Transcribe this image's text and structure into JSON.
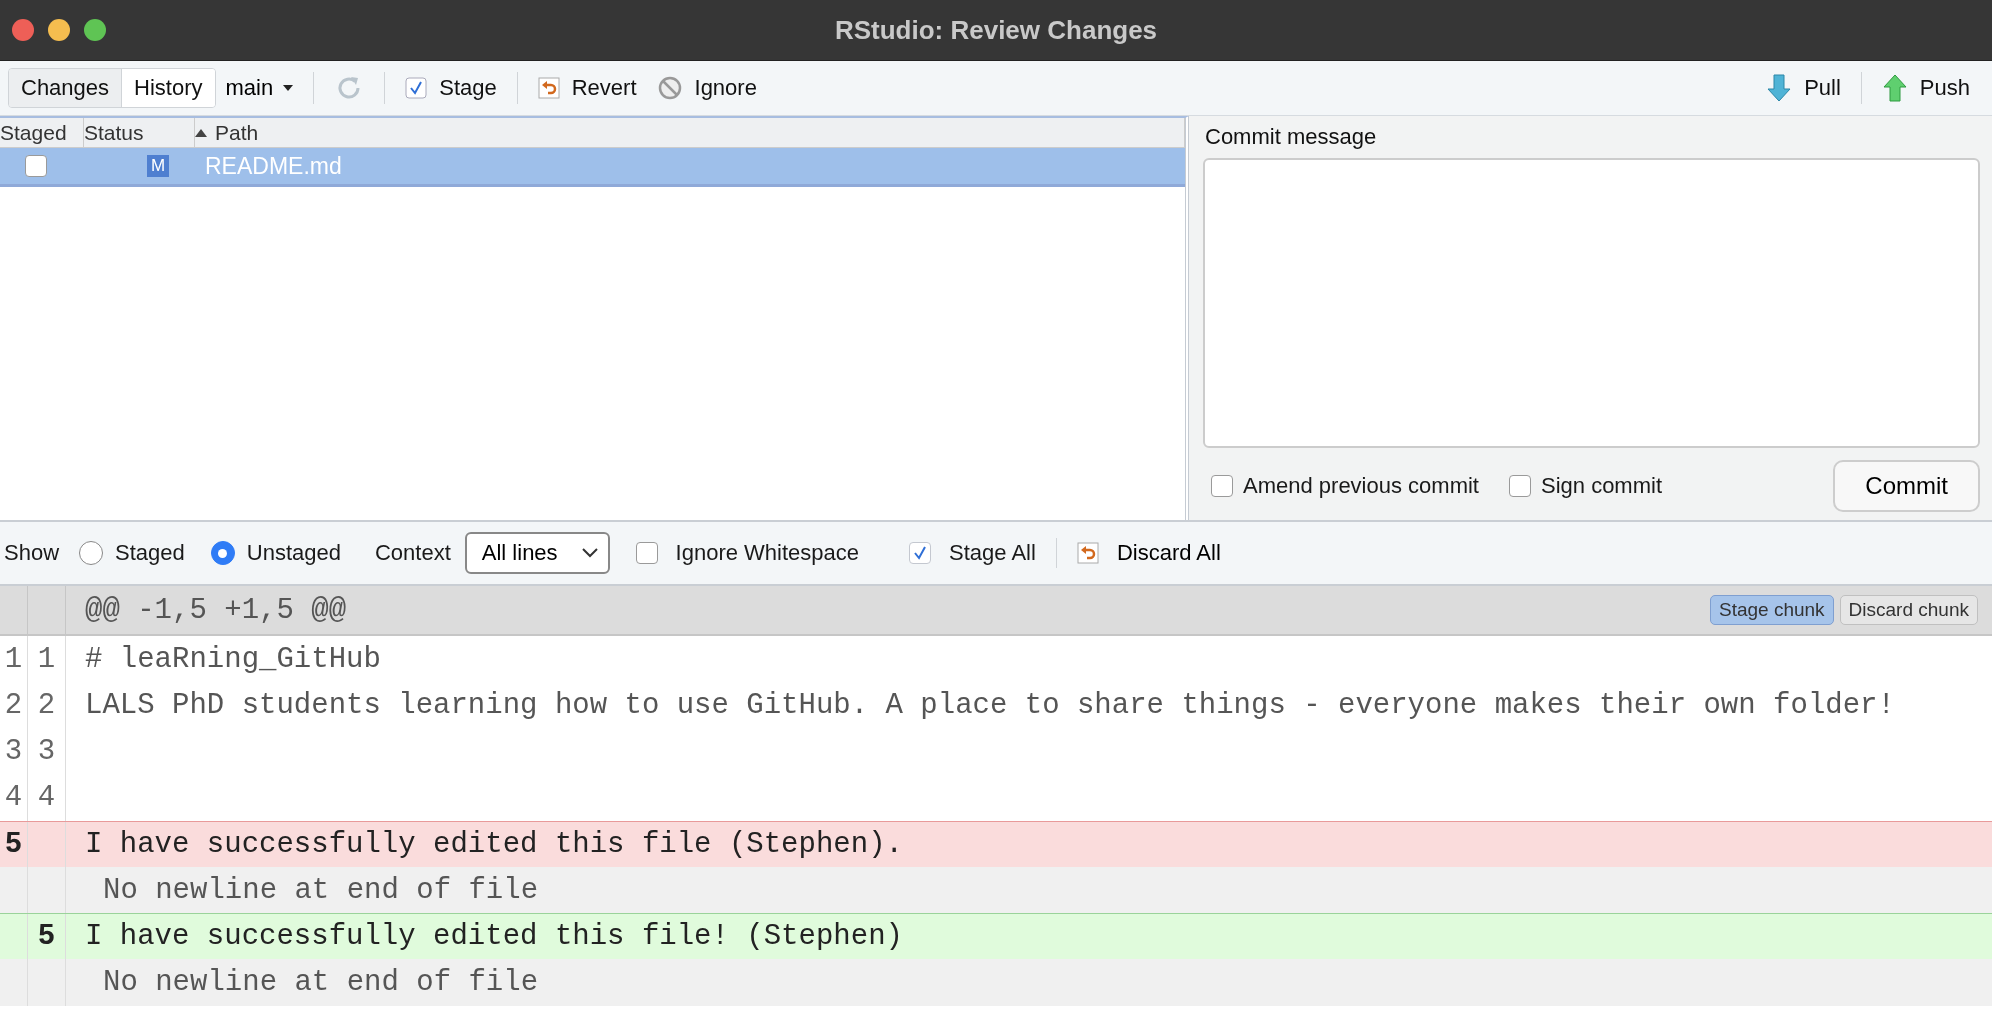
{
  "window": {
    "title": "RStudio: Review Changes"
  },
  "toolbar": {
    "view_tabs": [
      {
        "label": "Changes",
        "selected": true
      },
      {
        "label": "History",
        "selected": false
      }
    ],
    "branch": "main",
    "actions": [
      {
        "kind": "refresh"
      },
      {
        "kind": "stage",
        "label": "Stage"
      },
      {
        "kind": "revert",
        "label": "Revert"
      },
      {
        "kind": "ignore",
        "label": "Ignore"
      }
    ],
    "remote": [
      {
        "kind": "pull",
        "label": "Pull"
      },
      {
        "kind": "push",
        "label": "Push"
      }
    ]
  },
  "file_table": {
    "columns": [
      {
        "label": "Staged",
        "sorted": false
      },
      {
        "label": "Status",
        "sorted": false
      },
      {
        "label": "Path",
        "sorted": true
      }
    ],
    "rows": [
      {
        "staged": false,
        "status": "M",
        "path": "README.md",
        "selected": true
      }
    ]
  },
  "commit": {
    "label": "Commit message",
    "options": [
      {
        "label": "Amend previous commit",
        "checked": false
      },
      {
        "label": "Sign commit",
        "checked": false
      }
    ],
    "button": "Commit"
  },
  "diff_toolbar": {
    "show_label": "Show",
    "show_options": [
      {
        "label": "Staged",
        "selected": false
      },
      {
        "label": "Unstaged",
        "selected": true
      }
    ],
    "context_label": "Context",
    "context_value": "All lines",
    "ignore_whitespace": {
      "label": "Ignore Whitespace",
      "checked": false
    },
    "stage_all": {
      "label": "Stage All",
      "checked": true
    },
    "discard_all": "Discard All"
  },
  "diff": {
    "hunk_header": "@@ -1,5 +1,5 @@",
    "hunk_buttons": [
      {
        "label": "Stage chunk",
        "selected": true
      },
      {
        "label": "Discard chunk",
        "selected": false
      }
    ],
    "lines": [
      {
        "kind": "context",
        "old": "1",
        "new": "1",
        "text": "# leaRning_GitHub"
      },
      {
        "kind": "context",
        "old": "2",
        "new": "2",
        "text": "LALS PhD students learning how to use GitHub. A place to share things - everyone makes their own folder!"
      },
      {
        "kind": "context",
        "old": "3",
        "new": "3"
      },
      {
        "kind": "context",
        "old": "4",
        "new": "4"
      },
      {
        "kind": "deleted",
        "old": "5",
        "text": "I have successfully edited this file (Stephen)."
      },
      {
        "kind": "note",
        "text": "No newline at end of file"
      },
      {
        "kind": "added",
        "new": "5",
        "text": "I have successfully edited this file! (Stephen)"
      },
      {
        "kind": "note",
        "text": "No newline at end of file"
      }
    ]
  }
}
